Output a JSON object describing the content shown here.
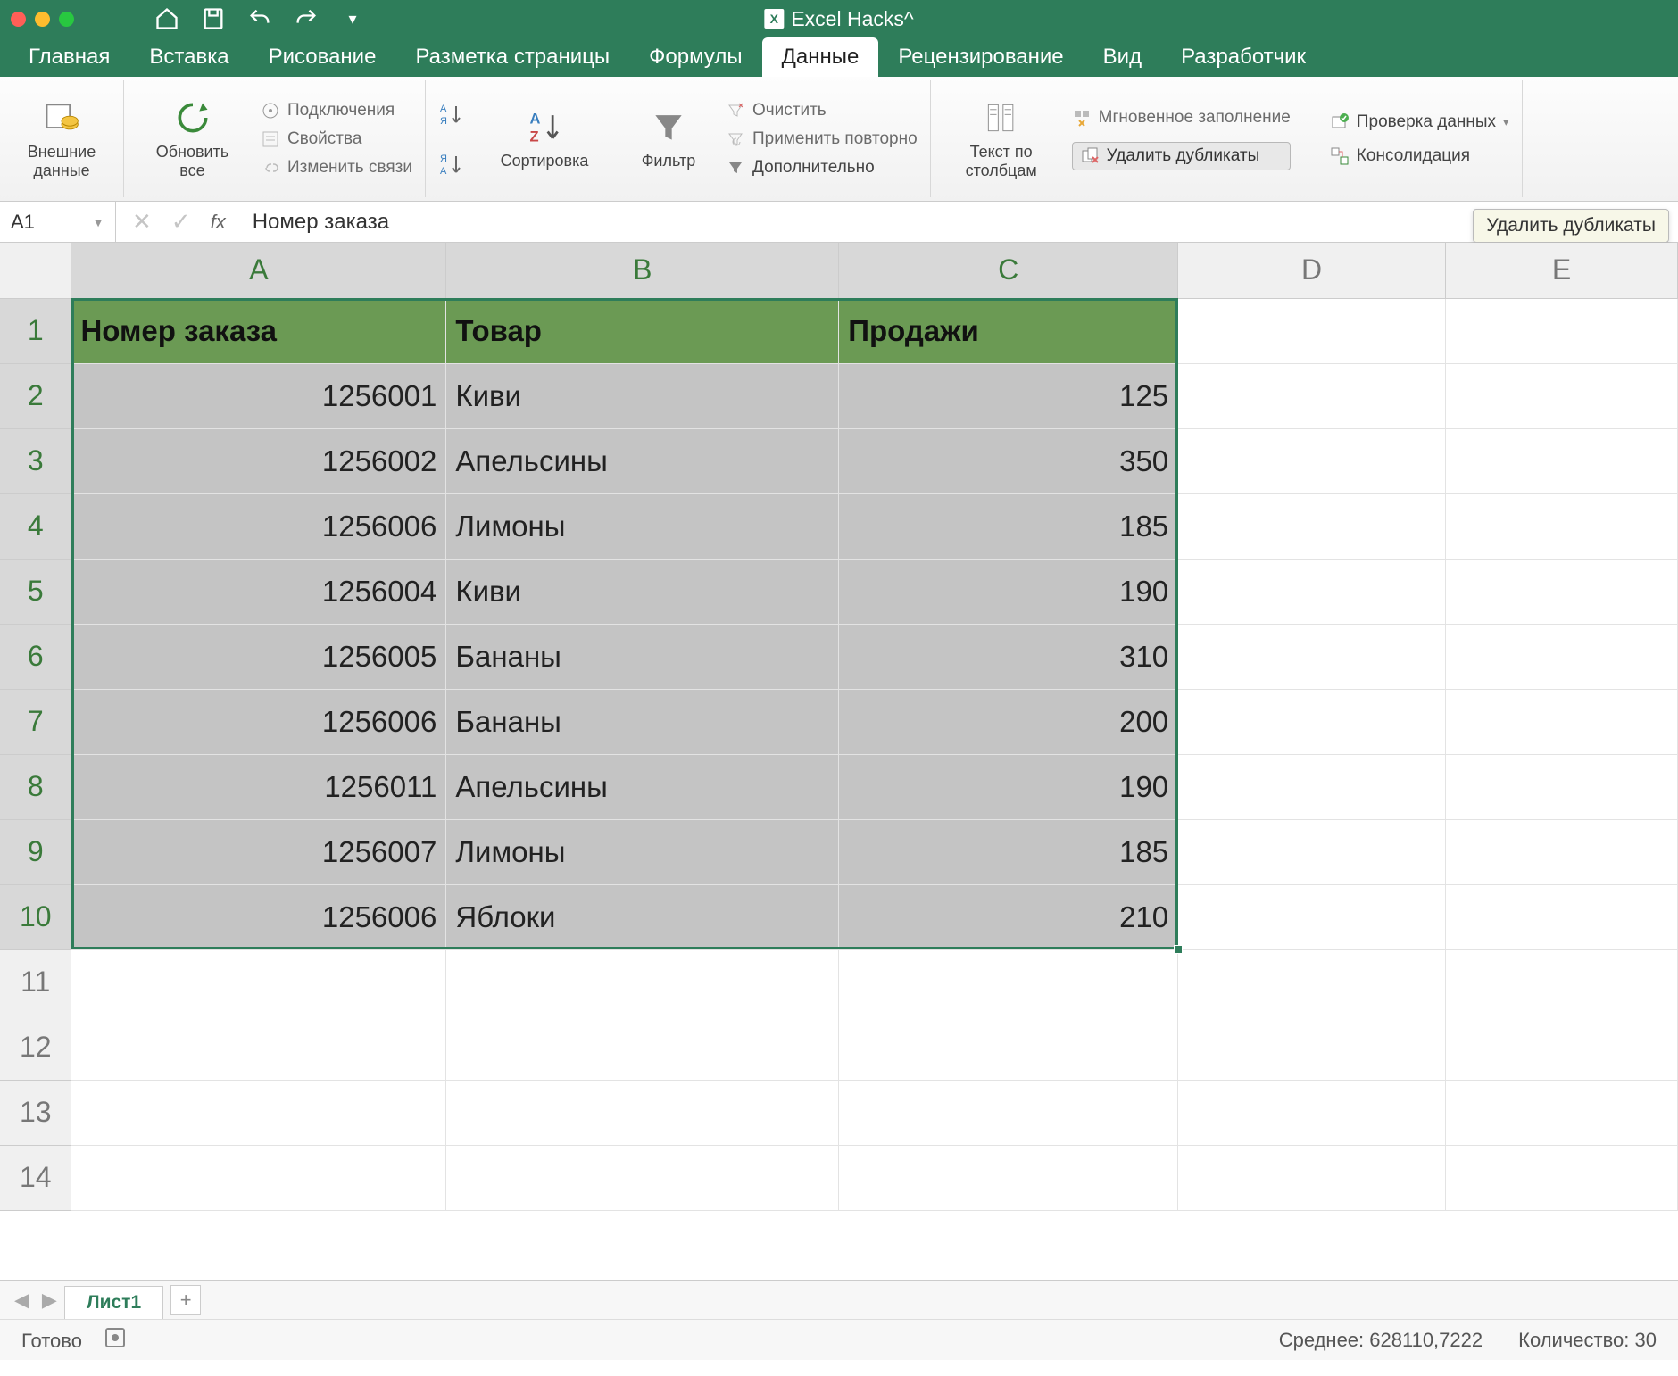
{
  "app_title": "Excel Hacks^",
  "tabs": [
    "Главная",
    "Вставка",
    "Рисование",
    "Разметка страницы",
    "Формулы",
    "Данные",
    "Рецензирование",
    "Вид",
    "Разработчик"
  ],
  "active_tab_index": 5,
  "ribbon": {
    "external_data": "Внешние\nданные",
    "refresh_all": "Обновить\nвсе",
    "connections": "Подключения",
    "properties": "Свойства",
    "edit_links": "Изменить связи",
    "sort": "Сортировка",
    "filter": "Фильтр",
    "clear": "Очистить",
    "reapply": "Применить повторно",
    "advanced": "Дополнительно",
    "text_to_columns": "Текст по\nстолбцам",
    "flash_fill": "Мгновенное заполнение",
    "remove_duplicates": "Удалить дубликаты",
    "data_validation": "Проверка данных",
    "consolidation": "Консолидация"
  },
  "tooltip": "Удалить дубликаты",
  "name_box": "A1",
  "formula_value": "Номер заказа",
  "columns": [
    "A",
    "B",
    "C",
    "D",
    "E"
  ],
  "row_numbers": [
    1,
    2,
    3,
    4,
    5,
    6,
    7,
    8,
    9,
    10,
    11,
    12,
    13,
    14
  ],
  "headers": [
    "Номер заказа",
    "Товар",
    "Продажи"
  ],
  "data_rows": [
    {
      "order": 1256001,
      "item": "Киви",
      "sales": 125
    },
    {
      "order": 1256002,
      "item": "Апельсины",
      "sales": 350
    },
    {
      "order": 1256006,
      "item": "Лимоны",
      "sales": 185
    },
    {
      "order": 1256004,
      "item": "Киви",
      "sales": 190
    },
    {
      "order": 1256005,
      "item": "Бананы",
      "sales": 310
    },
    {
      "order": 1256006,
      "item": "Бананы",
      "sales": 200
    },
    {
      "order": 1256011,
      "item": "Апельсины",
      "sales": 190
    },
    {
      "order": 1256007,
      "item": "Лимоны",
      "sales": 185
    },
    {
      "order": 1256006,
      "item": "Яблоки",
      "sales": 210
    }
  ],
  "sheet_name": "Лист1",
  "status": {
    "ready": "Готово",
    "average_label": "Среднее:",
    "average_value": "628110,7222",
    "count_label": "Количество:",
    "count_value": "30"
  }
}
